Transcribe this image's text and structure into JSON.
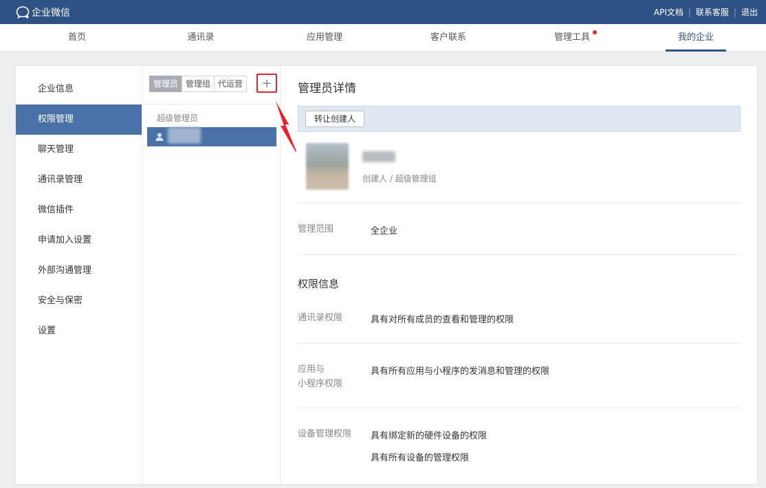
{
  "app": {
    "name": "企业微信"
  },
  "top_links": [
    "API文档",
    "联系客服",
    "退出"
  ],
  "nav": [
    {
      "label": "首页",
      "active": false
    },
    {
      "label": "通讯录",
      "active": false
    },
    {
      "label": "应用管理",
      "active": false
    },
    {
      "label": "客户联系",
      "active": false
    },
    {
      "label": "管理工具",
      "active": false,
      "badge": true
    },
    {
      "label": "我的企业",
      "active": true
    }
  ],
  "sidebar": {
    "items": [
      {
        "label": "企业信息",
        "active": false
      },
      {
        "label": "权限管理",
        "active": true
      },
      {
        "label": "聊天管理",
        "active": false
      },
      {
        "label": "通讯录管理",
        "active": false
      },
      {
        "label": "微信插件",
        "active": false
      },
      {
        "label": "申请加入设置",
        "active": false
      },
      {
        "label": "外部沟通管理",
        "active": false
      },
      {
        "label": "安全与保密",
        "active": false
      },
      {
        "label": "设置",
        "active": false
      }
    ]
  },
  "admin_list": {
    "tabs": [
      {
        "label": "管理员",
        "active": true
      },
      {
        "label": "管理组",
        "active": false
      },
      {
        "label": "代运营",
        "active": false
      }
    ],
    "add_symbol": "+",
    "group_label": "超级管理员"
  },
  "detail": {
    "title": "管理员详情",
    "transfer_button": "转让创建人",
    "role": "创建人 / 超级管理组",
    "scope_label": "管理范围",
    "scope_value": "全企业",
    "permissions_title": "权限信息",
    "contacts_label": "通讯录权限",
    "contacts_value": "具有对所有成员的查看和管理的权限",
    "apps_label_line1": "应用与",
    "apps_label_line2": "小程序权限",
    "apps_value": "具有所有应用与小程序的发消息和管理的权限",
    "device_label": "设备管理权限",
    "device_value1": "具有绑定新的硬件设备的权限",
    "device_value2": "具有所有设备的管理权限"
  },
  "colors": {
    "header": "#2f5284",
    "active_blue": "#4a72a8",
    "highlight_red": "#e8212b",
    "info_bar": "#dfe8f3"
  },
  "icons": [
    "chat-bubble-icon",
    "person-icon",
    "plus-icon",
    "red-arrow-annotation"
  ]
}
